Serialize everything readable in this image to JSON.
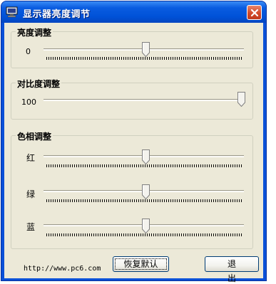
{
  "window": {
    "title": "显示器亮度调节",
    "colors": {
      "titlebar": "#0052d8",
      "client": "#ece9d8",
      "close": "#d24a2a"
    }
  },
  "brightness": {
    "group_label": "亮度调整",
    "value_text": "0",
    "slider_value": 0.52
  },
  "contrast": {
    "group_label": "对比度调整",
    "value_text": "100",
    "slider_value": 1.0
  },
  "hue": {
    "group_label": "色相调整",
    "channels": [
      {
        "label": "红",
        "slider_value": 0.52
      },
      {
        "label": "绿",
        "slider_value": 0.52
      },
      {
        "label": "蓝",
        "slider_value": 0.52
      }
    ]
  },
  "footer": {
    "url": "http://www.pc6.com",
    "reset_label": "恢复默认",
    "exit_label": "退出"
  },
  "icons": [
    "monitor-icon",
    "close-icon",
    "slider-thumb-icon"
  ]
}
